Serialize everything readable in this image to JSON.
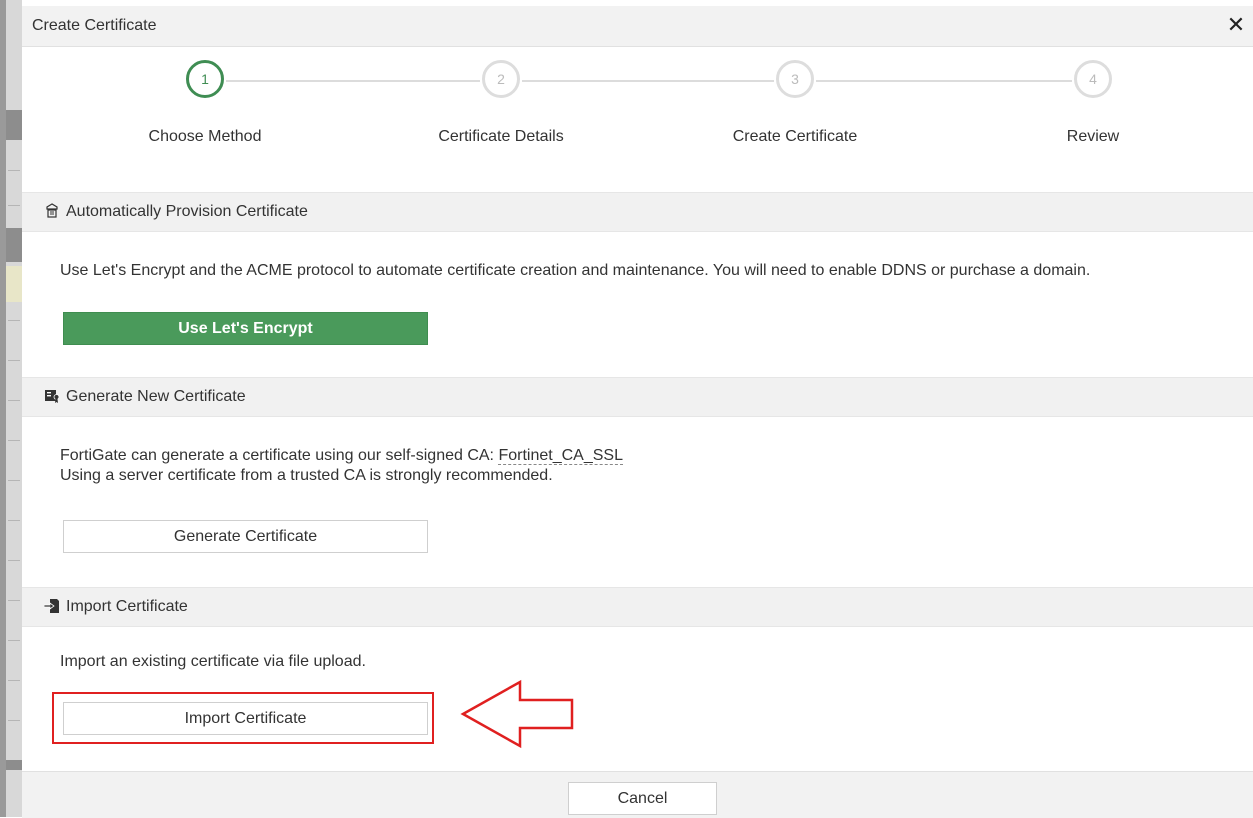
{
  "dialog": {
    "title": "Create Certificate"
  },
  "wizard": {
    "steps": [
      {
        "number": "1",
        "label": "Choose Method",
        "state": "active"
      },
      {
        "number": "2",
        "label": "Certificate Details",
        "state": "inactive"
      },
      {
        "number": "3",
        "label": "Create Certificate",
        "state": "inactive"
      },
      {
        "number": "4",
        "label": "Review",
        "state": "inactive"
      }
    ]
  },
  "sections": {
    "auto": {
      "title": "Automatically Provision Certificate",
      "description": "Use Let's Encrypt and the ACME protocol to automate certificate creation and maintenance. You will need to enable DDNS or purchase a domain.",
      "button": "Use Let's Encrypt"
    },
    "generate": {
      "title": "Generate New Certificate",
      "description_prefix": "FortiGate can generate a certificate using our self-signed CA: ",
      "ca_link": "Fortinet_CA_SSL",
      "description_line2": "Using a server certificate from a trusted CA is strongly recommended.",
      "button": "Generate Certificate"
    },
    "import": {
      "title": "Import Certificate",
      "description": "Import an existing certificate via file upload.",
      "button": "Import Certificate"
    }
  },
  "footer": {
    "cancel": "Cancel"
  },
  "colors": {
    "accent_green": "#4a9a5b",
    "annotation_red": "#e02020"
  }
}
